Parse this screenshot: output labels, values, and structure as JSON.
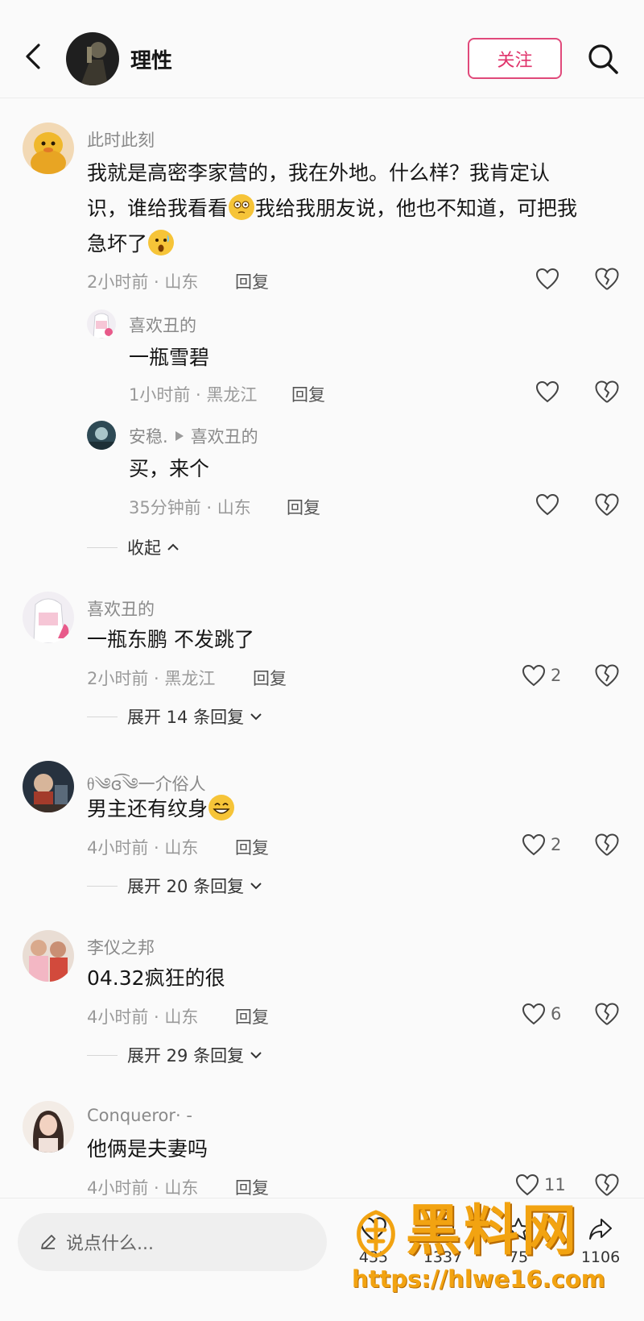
{
  "header": {
    "title": "理性",
    "follow_label": "关注"
  },
  "comments": [
    {
      "user": "此时此刻",
      "text_1": "我就是高密李家营的，我在外地。什么样？我肯定认",
      "text_2a": "识，谁给我看看",
      "text_2b": "我给我朋友说，他也不知道，可把我",
      "text_3": "急坏了",
      "meta": "2小时前 · 山东",
      "reply": "回复",
      "replies": [
        {
          "user": "喜欢丑的",
          "text": "一瓶雪碧",
          "meta": "1小时前 · 黑龙江",
          "reply": "回复"
        },
        {
          "user": "安稳.",
          "reply_to": "喜欢丑的",
          "text": "买，来个",
          "meta": "35分钟前 · 山东",
          "reply": "回复"
        }
      ],
      "collapse": "收起"
    },
    {
      "user": "喜欢丑的",
      "text": "一瓶东鹏 不发跳了",
      "meta": "2小时前 · 黑龙江",
      "reply": "回复",
      "likes": "2",
      "expand": "展开 14 条回复"
    },
    {
      "user": "ᦲ༄ɞ͡༄一介俗人",
      "text": "男主还有纹身",
      "meta": "4小时前 · 山东",
      "reply": "回复",
      "likes": "2",
      "expand": "展开 20 条回复"
    },
    {
      "user": "李仪之邦",
      "text": "04.32疯狂的很",
      "meta": "4小时前 · 山东",
      "reply": "回复",
      "likes": "6",
      "expand": "展开 29 条回复"
    },
    {
      "user": "Conqueror· -",
      "text": "他俩是夫妻吗",
      "meta": "4小时前 · 山东",
      "reply": "回复",
      "likes": "11"
    }
  ],
  "bottom": {
    "placeholder": "说点什么...",
    "stats": [
      "435",
      "1337",
      "75",
      "1106"
    ]
  },
  "watermark": {
    "title": "黑料网",
    "url": "https://hlwe16.com"
  },
  "colors": {
    "accent": "#e0336b",
    "watermark": "#f2a311"
  }
}
